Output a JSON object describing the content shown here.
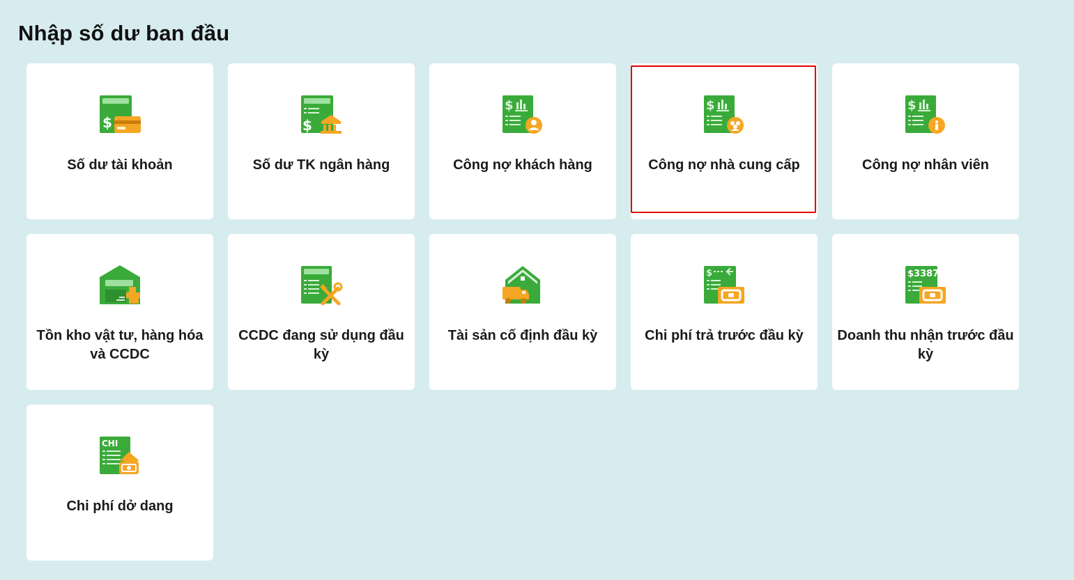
{
  "page": {
    "title": "Nhập số dư ban đầu"
  },
  "colors": {
    "background": "#d7ecef",
    "icon_green": "#3aaa3a",
    "icon_orange": "#f5a623",
    "selected_border": "#e00000"
  },
  "cards": [
    {
      "label": "Số dư tài khoản",
      "icon": "account-balance-card-icon",
      "selected": false
    },
    {
      "label": "Số dư TK ngân hàng",
      "icon": "bank-account-balance-icon",
      "selected": false
    },
    {
      "label": "Công nợ khách hàng",
      "icon": "customer-debt-icon",
      "selected": false
    },
    {
      "label": "Công nợ nhà cung cấp",
      "icon": "supplier-debt-icon",
      "selected": true
    },
    {
      "label": "Công nợ nhân viên",
      "icon": "employee-debt-icon",
      "selected": false
    },
    {
      "label": "Tồn kho vật tư, hàng hóa và CCDC",
      "icon": "warehouse-inventory-icon",
      "selected": false
    },
    {
      "label": "CCDC đang sử dụng đầu kỳ",
      "icon": "tools-in-use-icon",
      "selected": false
    },
    {
      "label": "Tài sản cố định đầu kỳ",
      "icon": "fixed-asset-icon",
      "selected": false
    },
    {
      "label": "Chi phí trả trước đầu kỳ",
      "icon": "prepaid-expense-icon",
      "selected": false
    },
    {
      "label": "Doanh thu nhận trước đầu kỳ",
      "icon": "unearned-revenue-icon",
      "selected": false,
      "icon_text": "$3387"
    },
    {
      "label": "Chi phí dở dang",
      "icon": "work-in-progress-cost-icon",
      "selected": false,
      "icon_text": "CHI"
    }
  ]
}
